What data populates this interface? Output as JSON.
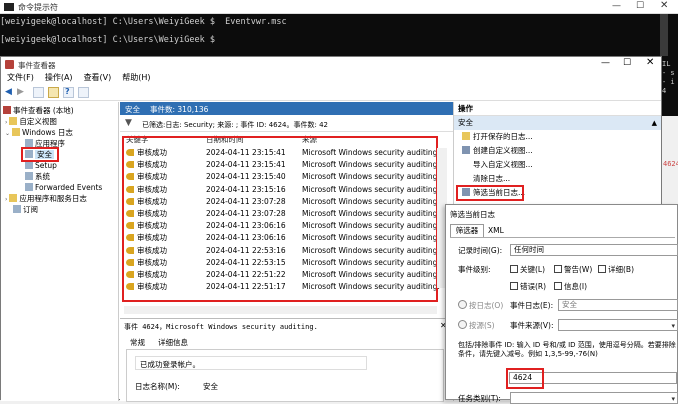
{
  "console": {
    "title": "命令提示符",
    "line1": "[weiyigeek@localhost] C:\\Users\\WeiyiGeek $  Eventvwr.msc",
    "line2": "[weiyigeek@localhost] C:\\Users\\WeiyiGeek $",
    "side_text": [
      "IL",
      "- s -",
      "- i -",
      "4",
      "-",
      "",
      "-"
    ],
    "right_edge": "4624"
  },
  "mmc": {
    "title": "事件查看器",
    "menu": [
      "文件(F)",
      "操作(A)",
      "查看(V)",
      "帮助(H)"
    ],
    "tree": [
      {
        "label": "事件查看器 (本地)",
        "level": 0
      },
      {
        "label": "自定义视图",
        "level": 1
      },
      {
        "label": "Windows 日志",
        "level": 1
      },
      {
        "label": "应用程序",
        "level": 2
      },
      {
        "label": "安全",
        "level": 2
      },
      {
        "label": "Setup",
        "level": 2
      },
      {
        "label": "系统",
        "level": 2
      },
      {
        "label": "Forwarded Events",
        "level": 2
      },
      {
        "label": "应用程序和服务日志",
        "level": 1
      },
      {
        "label": "订阅",
        "level": 1
      }
    ],
    "log_header": {
      "name": "安全",
      "count_label": "事件数: 310,136"
    },
    "filter_text": "已筛选:日志: Security; 来源: ; 事件 ID: 4624。事件数: 42",
    "columns": [
      "关键字",
      "日期和时间",
      "来源"
    ],
    "rows": [
      {
        "kw": "审核成功",
        "dt": "2024-04-11 23:15:41",
        "src": "Microsoft Windows security auditing."
      },
      {
        "kw": "审核成功",
        "dt": "2024-04-11 23:15:41",
        "src": "Microsoft Windows security auditing."
      },
      {
        "kw": "审核成功",
        "dt": "2024-04-11 23:15:40",
        "src": "Microsoft Windows security auditing."
      },
      {
        "kw": "审核成功",
        "dt": "2024-04-11 23:15:16",
        "src": "Microsoft Windows security auditing."
      },
      {
        "kw": "审核成功",
        "dt": "2024-04-11 23:07:28",
        "src": "Microsoft Windows security auditing."
      },
      {
        "kw": "审核成功",
        "dt": "2024-04-11 23:07:28",
        "src": "Microsoft Windows security auditing."
      },
      {
        "kw": "审核成功",
        "dt": "2024-04-11 23:06:16",
        "src": "Microsoft Windows security auditing."
      },
      {
        "kw": "审核成功",
        "dt": "2024-04-11 23:06:16",
        "src": "Microsoft Windows security auditing."
      },
      {
        "kw": "审核成功",
        "dt": "2024-04-11 22:53:16",
        "src": "Microsoft Windows security auditing."
      },
      {
        "kw": "审核成功",
        "dt": "2024-04-11 22:53:15",
        "src": "Microsoft Windows security auditing."
      },
      {
        "kw": "审核成功",
        "dt": "2024-04-11 22:51:22",
        "src": "Microsoft Windows security auditing."
      },
      {
        "kw": "审核成功",
        "dt": "2024-04-11 22:51:17",
        "src": "Microsoft Windows security auditing."
      }
    ],
    "detail": {
      "title": "事件 4624，Microsoft Windows security auditing.",
      "tab_general": "常规",
      "tab_details": "详细信息",
      "message": "已成功登录帐户。",
      "log_name_label": "日志名称(M):",
      "log_name_value": "安全"
    },
    "actions": {
      "header": "操作",
      "section": "安全",
      "items": [
        "打开保存的日志...",
        "创建自定义视图...",
        "导入自定义视图...",
        "清除日志...",
        "筛选当前日志..."
      ]
    }
  },
  "dialog": {
    "title": "筛选当前日志",
    "tabs": [
      "筛选器",
      "XML"
    ],
    "logged_label": "记录时间(G):",
    "logged_value": "任何时间",
    "level_label": "事件级别:",
    "levels": [
      "关键(L)",
      "警告(W)",
      "详细(B)",
      "错误(R)",
      "信息(I)"
    ],
    "by_log": "按日志(O)",
    "event_log_label": "事件日志(E):",
    "event_log_value": "安全",
    "by_source": "按源(S)",
    "event_source_label": "事件来源(V):",
    "include_hint": "包括/排除事件 ID: 输入 ID 号和/或 ID 范围，使用逗号分隔。若要排除条件，请先键入减号。例如 1,3,5-99,-76(N)",
    "id_value": "4624",
    "task_label": "任务类别(T):"
  }
}
